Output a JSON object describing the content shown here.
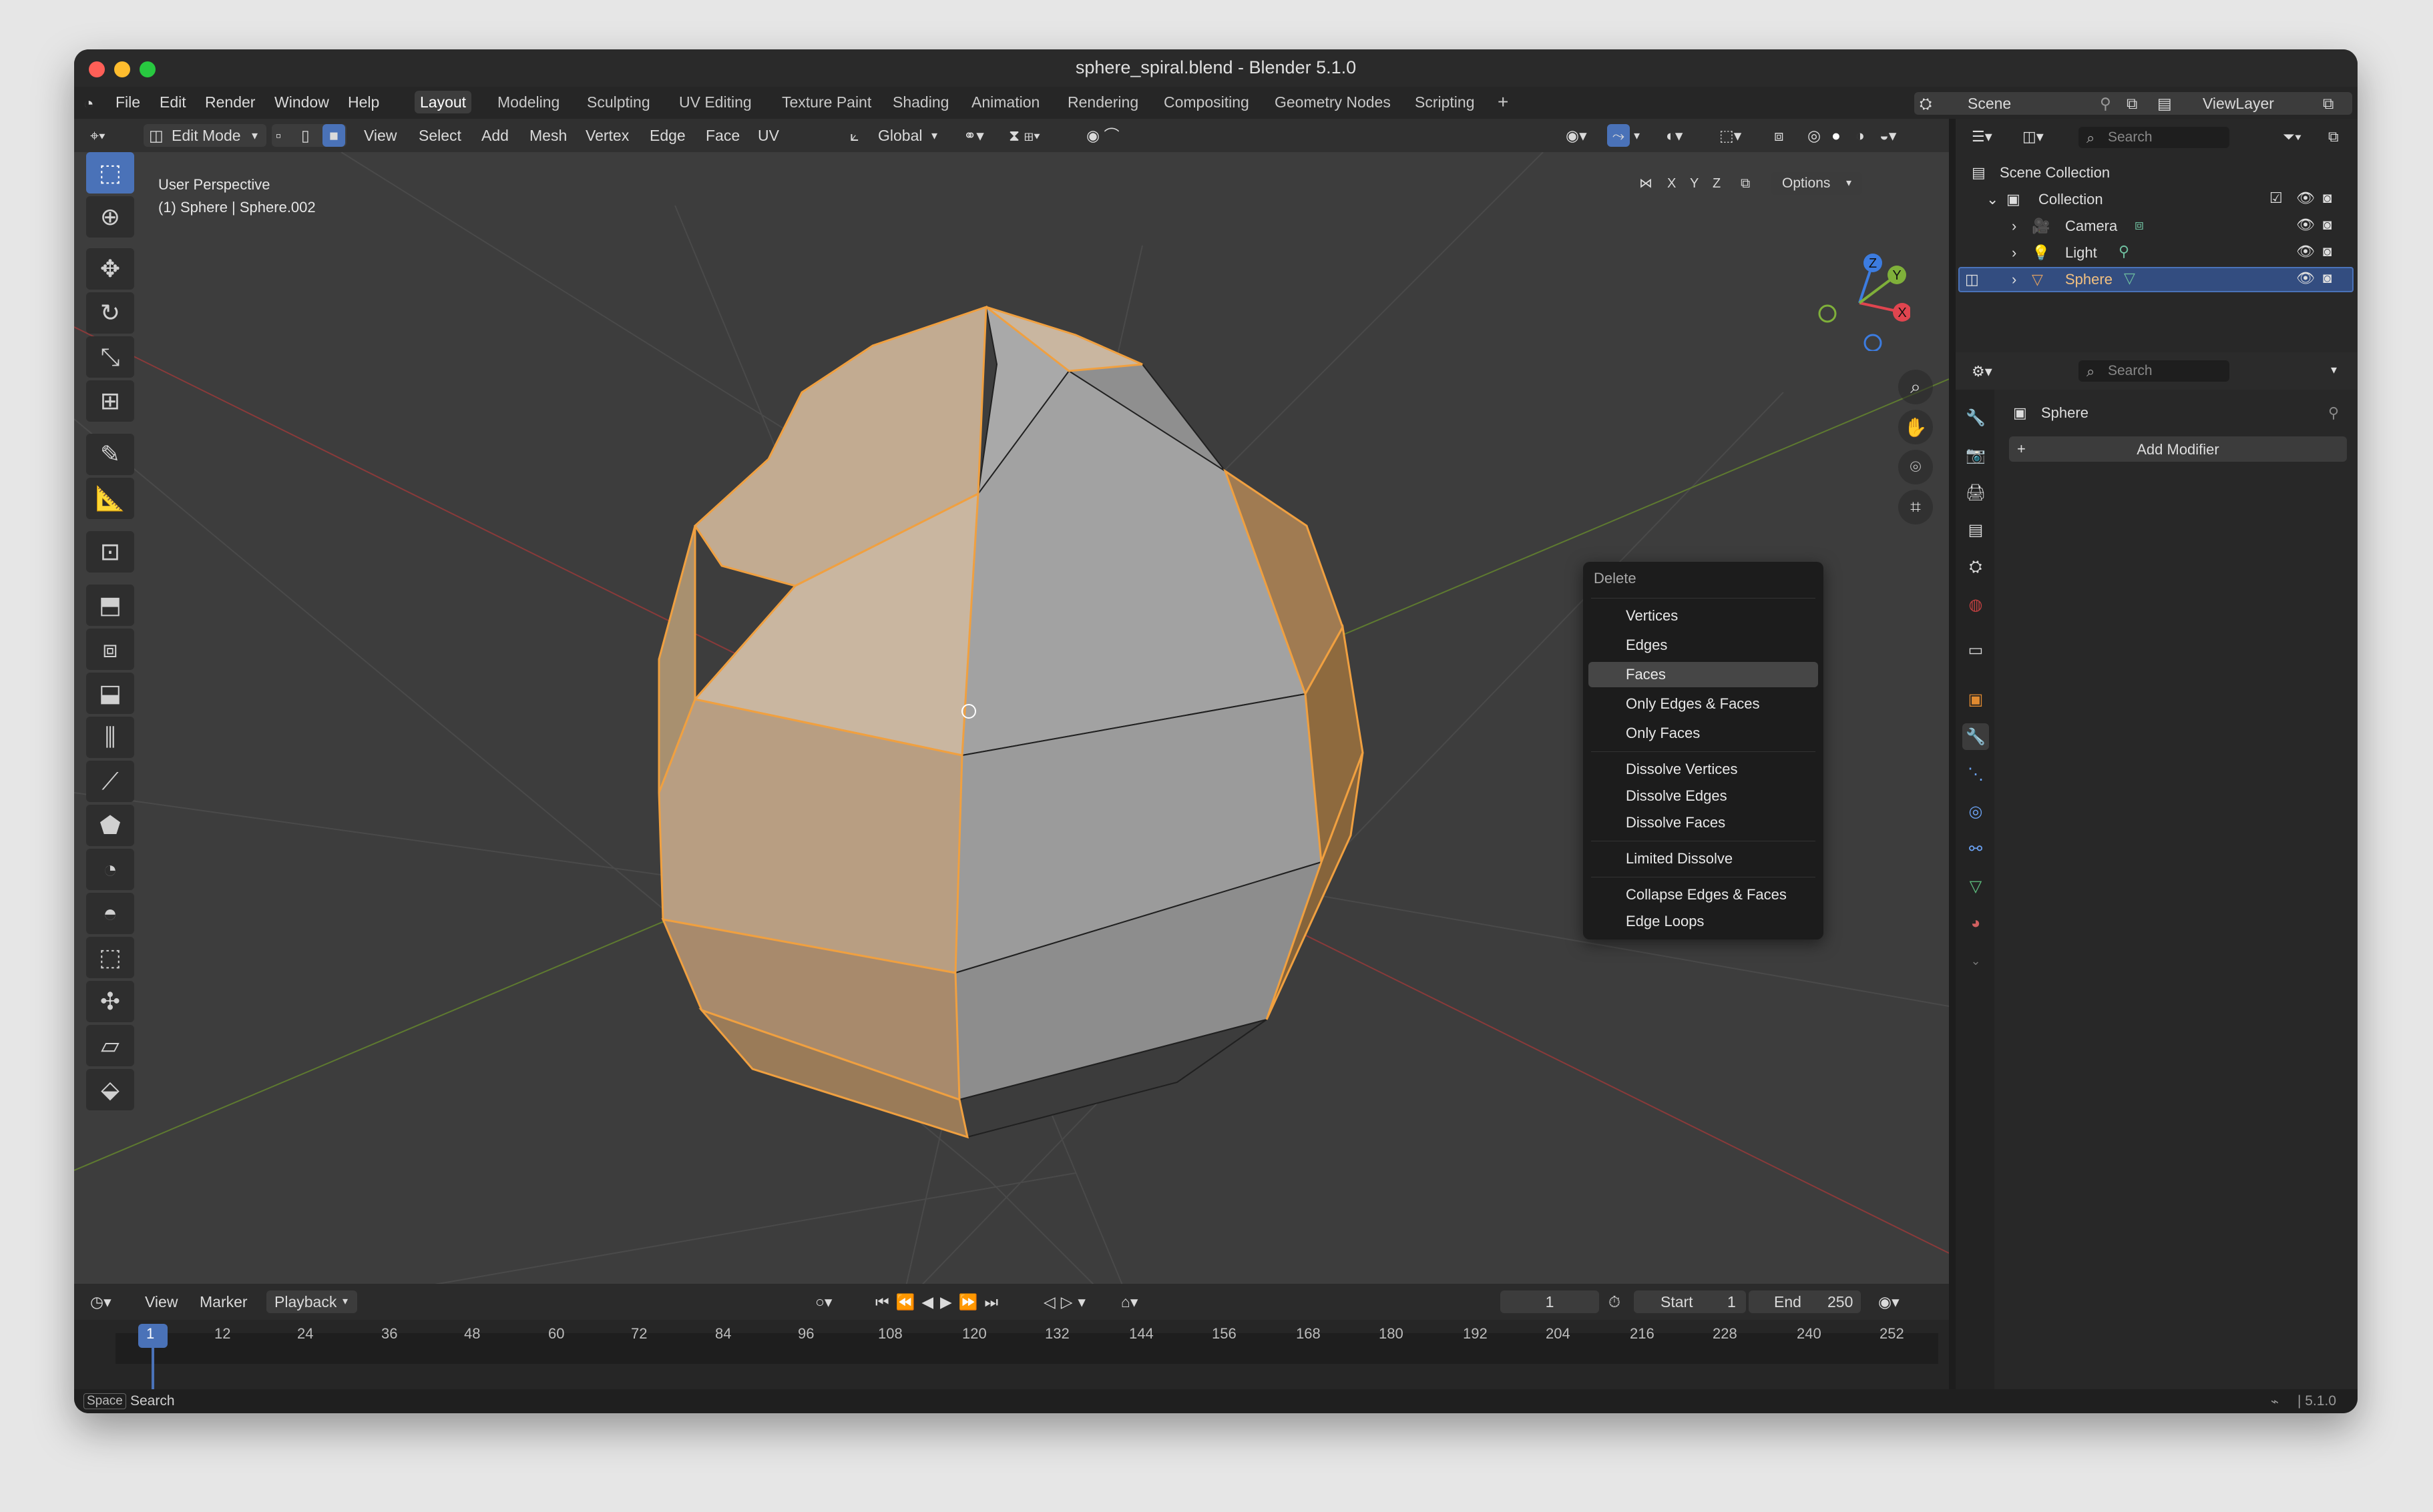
{
  "window": {
    "title": "sphere_spiral.blend - Blender 5.1.0"
  },
  "menu": {
    "items": [
      "File",
      "Edit",
      "Render",
      "Window",
      "Help"
    ]
  },
  "workspaces": [
    "Layout",
    "Modeling",
    "Sculpting",
    "UV Editing",
    "Texture Paint",
    "Shading",
    "Animation",
    "Rendering",
    "Compositing",
    "Geometry Nodes",
    "Scripting"
  ],
  "active_workspace": "Layout",
  "scene": {
    "name": "Scene",
    "view_layer": "ViewLayer"
  },
  "header": {
    "mode": "Edit Mode",
    "menus": [
      "View",
      "Select",
      "Add",
      "Mesh",
      "Vertex",
      "Edge",
      "Face",
      "UV"
    ],
    "orientation": "Global",
    "options": "Options",
    "axes": [
      "X",
      "Y",
      "Z"
    ]
  },
  "viewport": {
    "perspective": "User Perspective",
    "object_info": "(1) Sphere | Sphere.002",
    "gizmo": {
      "z": "Z",
      "y": "Y",
      "x": "X"
    }
  },
  "context_menu": {
    "title": "Delete",
    "groups": [
      [
        "Vertices",
        "Edges",
        "Faces",
        "Only Edges & Faces",
        "Only Faces"
      ],
      [
        "Dissolve Vertices",
        "Dissolve Edges",
        "Dissolve Faces"
      ],
      [
        "Limited Dissolve"
      ],
      [
        "Collapse Edges & Faces",
        "Edge Loops"
      ]
    ],
    "highlighted": "Faces"
  },
  "timeline": {
    "menus": [
      "View",
      "Marker",
      "Playback"
    ],
    "current_frame": "1",
    "start_label": "Start",
    "start": "1",
    "end_label": "End",
    "end": "250",
    "ruler": [
      "1",
      "12",
      "24",
      "36",
      "48",
      "60",
      "72",
      "84",
      "96",
      "108",
      "120",
      "132",
      "144",
      "156",
      "168",
      "180",
      "192",
      "204",
      "216",
      "228",
      "240",
      "252"
    ]
  },
  "outliner": {
    "search_placeholder": "Search",
    "root": "Scene Collection",
    "collection": "Collection",
    "items": [
      "Camera",
      "Light",
      "Sphere"
    ],
    "selected": "Sphere"
  },
  "properties": {
    "search_placeholder": "Search",
    "object": "Sphere",
    "add_modifier": "Add Modifier"
  },
  "statusbar": {
    "key": "Space",
    "action": "Search",
    "version": "5.1.0"
  },
  "colors": {
    "accent": "#4a72b8",
    "selection": "#f0a040",
    "x_axis": "#e0454f",
    "y_axis": "#7fb03a",
    "z_axis": "#3c7ce0"
  }
}
